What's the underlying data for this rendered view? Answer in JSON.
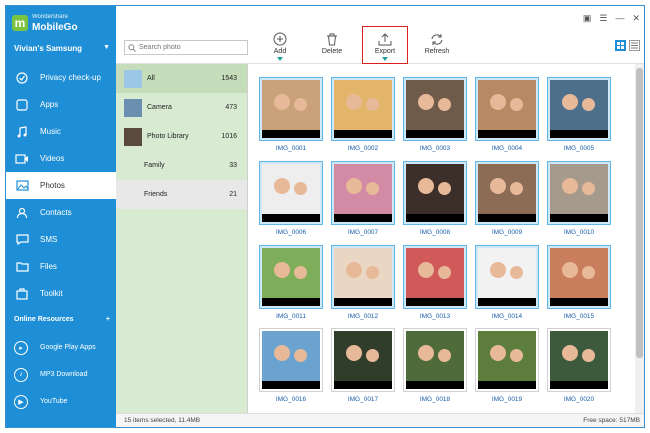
{
  "app": {
    "brand_small": "Wondershare",
    "brand_name": "MobileGo",
    "logo_letter": "m"
  },
  "device": {
    "name": "Vivian's Samsung"
  },
  "nav": [
    {
      "label": "Privacy check-up",
      "icon": "privacy-check-icon"
    },
    {
      "label": "Apps",
      "icon": "apps-icon"
    },
    {
      "label": "Music",
      "icon": "music-icon"
    },
    {
      "label": "Videos",
      "icon": "videos-icon"
    },
    {
      "label": "Photos",
      "icon": "photos-icon"
    },
    {
      "label": "Contacts",
      "icon": "contacts-icon"
    },
    {
      "label": "SMS",
      "icon": "sms-icon"
    },
    {
      "label": "Files",
      "icon": "files-icon"
    },
    {
      "label": "Toolkit",
      "icon": "toolkit-icon"
    }
  ],
  "online": {
    "title": "Online Resources",
    "plus": "+",
    "items": [
      {
        "label": "Google Play Apps",
        "icon": "google-play-icon"
      },
      {
        "label": "MP3 Download",
        "icon": "mp3-download-icon"
      },
      {
        "label": "YouTube",
        "icon": "youtube-icon"
      }
    ]
  },
  "search": {
    "placeholder": "Search photo"
  },
  "toolbar": {
    "add": "Add",
    "delete": "Delete",
    "export": "Export",
    "refresh": "Refresh"
  },
  "albums": [
    {
      "name": "All",
      "count": "1543"
    },
    {
      "name": "Camera",
      "count": "473"
    },
    {
      "name": "Photo Library",
      "count": "1016"
    },
    {
      "name": "Family",
      "count": "33"
    },
    {
      "name": "Friends",
      "count": "21"
    }
  ],
  "photos": [
    {
      "name": "IMG_0001",
      "bg": "#c9a27a"
    },
    {
      "name": "IMG_0002",
      "bg": "#e2b56a"
    },
    {
      "name": "IMG_0003",
      "bg": "#6e5b4a"
    },
    {
      "name": "IMG_0004",
      "bg": "#b88a63"
    },
    {
      "name": "IMG_0005",
      "bg": "#4d6f8c"
    },
    {
      "name": "IMG_0006",
      "bg": "#eeeeee"
    },
    {
      "name": "IMG_0007",
      "bg": "#d38aa4"
    },
    {
      "name": "IMG_0008",
      "bg": "#3c2f29"
    },
    {
      "name": "IMG_0009",
      "bg": "#8c6c55"
    },
    {
      "name": "IMG_0010",
      "bg": "#a59a8c"
    },
    {
      "name": "IMG_0011",
      "bg": "#7fae5a"
    },
    {
      "name": "IMG_0012",
      "bg": "#e9d7c4"
    },
    {
      "name": "IMG_0013",
      "bg": "#d05a5a"
    },
    {
      "name": "IMG_0014",
      "bg": "#f2f2f2"
    },
    {
      "name": "IMG_0015",
      "bg": "#c97f5e"
    },
    {
      "name": "IMG_0016",
      "bg": "#6aa3d0"
    },
    {
      "name": "IMG_0017",
      "bg": "#2f3d2a"
    },
    {
      "name": "IMG_0018",
      "bg": "#4f6b3a"
    },
    {
      "name": "IMG_0019",
      "bg": "#5d7d3c"
    },
    {
      "name": "IMG_0020",
      "bg": "#3e5a3c"
    }
  ],
  "status": {
    "selected": "15 items selected, 11.4MB",
    "free": "Free space: 517MB"
  },
  "colors": {
    "accent": "#1e8fd6",
    "album_panel": "#d9ead3",
    "export_highlight": "#d9201c"
  }
}
